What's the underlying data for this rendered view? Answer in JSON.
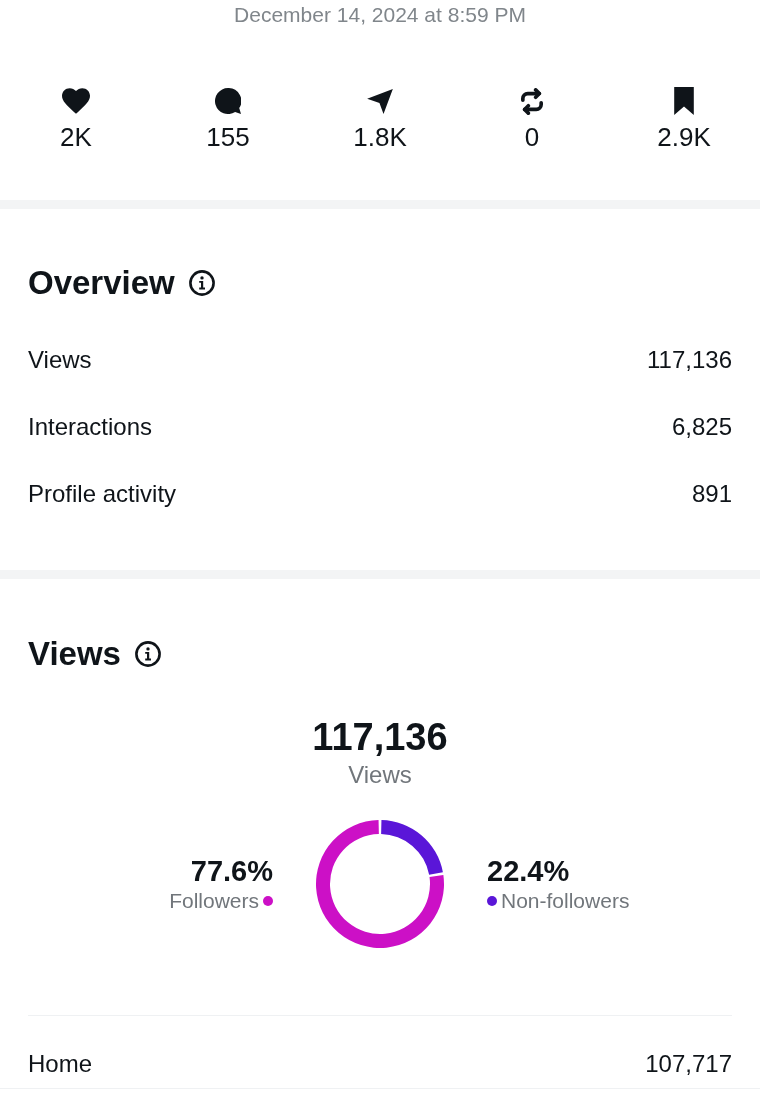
{
  "timestamp": "December 14, 2024 at 8:59 PM",
  "stats": [
    {
      "value": "2K"
    },
    {
      "value": "155"
    },
    {
      "value": "1.8K"
    },
    {
      "value": "0"
    },
    {
      "value": "2.9K"
    }
  ],
  "overview": {
    "title": "Overview",
    "rows": [
      {
        "label": "Views",
        "value": "117,136"
      },
      {
        "label": "Interactions",
        "value": "6,825"
      },
      {
        "label": "Profile activity",
        "value": "891"
      }
    ]
  },
  "views": {
    "title": "Views",
    "total": "117,136",
    "total_label": "Views",
    "chart_data": {
      "type": "donut",
      "categories": [
        "Followers",
        "Non-followers"
      ],
      "values": [
        77.6,
        22.4
      ],
      "value_labels": [
        "77.6%",
        "22.4%"
      ],
      "colors": [
        "#cc10c6",
        "#5a16d8"
      ]
    }
  },
  "sources": [
    {
      "label": "Home",
      "value": "107,717"
    }
  ]
}
